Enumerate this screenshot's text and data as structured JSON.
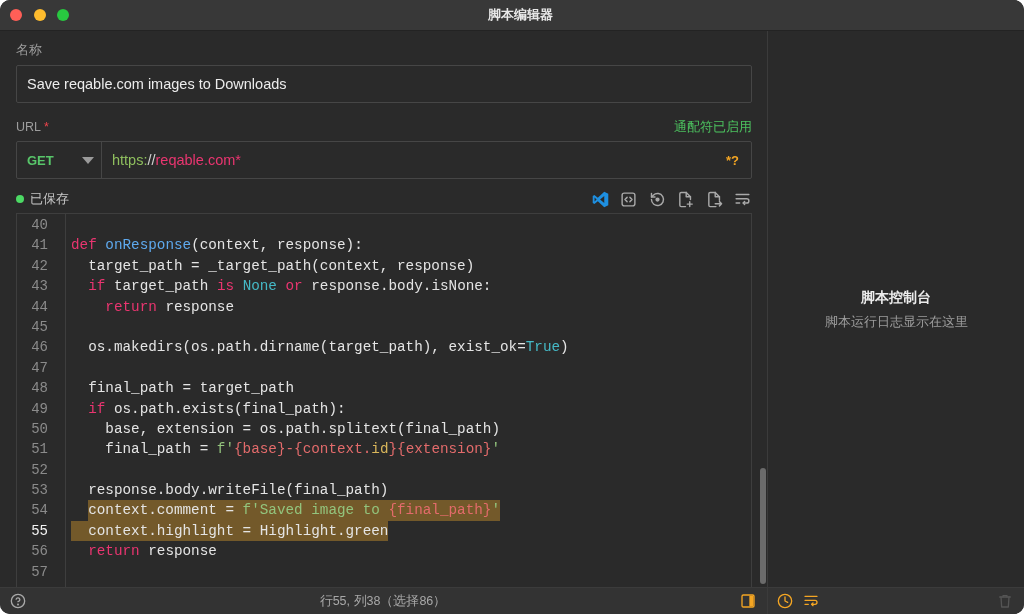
{
  "window": {
    "title": "脚本编辑器"
  },
  "name_field": {
    "label": "名称",
    "value": "Save reqable.com images to Downloads"
  },
  "url": {
    "label": "URL",
    "required_mark": "*",
    "wildcard_status": "通配符已启用",
    "method": "GET",
    "segments": [
      {
        "text": "https:",
        "kind": "scheme"
      },
      {
        "text": "//",
        "kind": "separator"
      },
      {
        "text": "reqable.com*",
        "kind": "host"
      }
    ],
    "wildcard_mark": "*?"
  },
  "editor": {
    "status": {
      "label": "已保存",
      "saved": true
    },
    "lines": [
      {
        "number": "40",
        "current": false,
        "selected": false
      },
      {
        "number": "41",
        "current": false,
        "selected": false,
        "tokens": [
          {
            "text": "def",
            "kind": "keyword"
          },
          {
            "text": " onResponse",
            "kind": "function"
          },
          {
            "text": "(context, response):",
            "kind": "plain"
          }
        ],
        "children": [
          {
            "number": "42",
            "current": false,
            "selected": false,
            "indent_selected": false,
            "tokens": [
              {
                "text": "target_path = _target_path(context, response)",
                "kind": "plain"
              }
            ]
          },
          {
            "number": "43",
            "current": false,
            "selected": false,
            "indent_selected": false,
            "tokens": [
              {
                "text": "if",
                "kind": "keyword"
              },
              {
                "text": " target_path ",
                "kind": "plain"
              },
              {
                "text": "is",
                "kind": "keyword"
              },
              {
                "text": " None",
                "kind": "constant"
              },
              {
                "text": " or",
                "kind": "keyword"
              },
              {
                "text": " response.body.isNone:",
                "kind": "plain"
              }
            ],
            "children": [
              {
                "number": "44",
                "current": false,
                "selected": false,
                "indent_selected": false,
                "tokens": [
                  {
                    "text": "return",
                    "kind": "keyword"
                  },
                  {
                    "text": " response",
                    "kind": "plain"
                  }
                ]
              }
            ]
          },
          {
            "number": "45",
            "current": false,
            "selected": false,
            "indent_selected": false
          },
          {
            "number": "46",
            "current": false,
            "selected": false,
            "indent_selected": false,
            "tokens": [
              {
                "text": "os.makedirs(os.path.dirname(target_path), exist_ok=",
                "kind": "plain"
              },
              {
                "text": "True",
                "kind": "constant"
              },
              {
                "text": ")",
                "kind": "plain"
              }
            ]
          },
          {
            "number": "47",
            "current": false,
            "selected": false,
            "indent_selected": false
          },
          {
            "number": "48",
            "current": false,
            "selected": false,
            "indent_selected": false,
            "tokens": [
              {
                "text": "final_path = target_path",
                "kind": "plain"
              }
            ]
          },
          {
            "number": "49",
            "current": false,
            "selected": false,
            "indent_selected": false,
            "tokens": [
              {
                "text": "if",
                "kind": "keyword"
              },
              {
                "text": " os.path.exists(final_path):",
                "kind": "plain"
              }
            ],
            "children": [
              {
                "number": "50",
                "current": false,
                "selected": false,
                "indent_selected": false,
                "tokens": [
                  {
                    "text": "base, extension = os.path.splitext(final_path)",
                    "kind": "plain"
                  }
                ]
              },
              {
                "number": "51",
                "current": false,
                "selected": false,
                "indent_selected": false,
                "tokens": [
                  {
                    "text": "final_path = ",
                    "kind": "plain"
                  },
                  {
                    "text": "f'",
                    "kind": "string"
                  },
                  {
                    "text": "{base}-{context.",
                    "kind": "interpolation"
                  },
                  {
                    "text": "id",
                    "kind": "attribute"
                  },
                  {
                    "text": "}{extension}",
                    "kind": "interpolation"
                  },
                  {
                    "text": "'",
                    "kind": "string"
                  }
                ]
              }
            ]
          },
          {
            "number": "52",
            "current": false,
            "selected": false,
            "indent_selected": false
          },
          {
            "number": "53",
            "current": false,
            "selected": false,
            "indent_selected": false,
            "tokens": [
              {
                "text": "response.body.writeFile(final_path)",
                "kind": "plain"
              }
            ]
          },
          {
            "number": "54",
            "current": false,
            "selected": true,
            "indent_selected": false,
            "tokens": [
              {
                "text": "context.comment = ",
                "kind": "plain"
              },
              {
                "text": "f'Saved image to ",
                "kind": "string"
              },
              {
                "text": "{final_path}",
                "kind": "interpolation"
              },
              {
                "text": "'",
                "kind": "string"
              }
            ]
          },
          {
            "number": "55",
            "current": true,
            "selected": true,
            "indent_selected": true,
            "tokens": [
              {
                "text": "context.highlight = Highlight.green",
                "kind": "plain"
              }
            ]
          },
          {
            "number": "56",
            "current": false,
            "selected": false,
            "indent_selected": false,
            "tokens": [
              {
                "text": "return",
                "kind": "keyword"
              },
              {
                "text": " response",
                "kind": "plain"
              }
            ]
          }
        ]
      },
      {
        "number": "57",
        "current": false,
        "selected": false
      }
    ]
  },
  "status_bar": {
    "cursor": "行55, 列38（选择86）"
  },
  "console": {
    "title": "脚本控制台",
    "hint": "脚本运行日志显示在这里",
    "clear_button": {
      "disabled": true
    }
  }
}
